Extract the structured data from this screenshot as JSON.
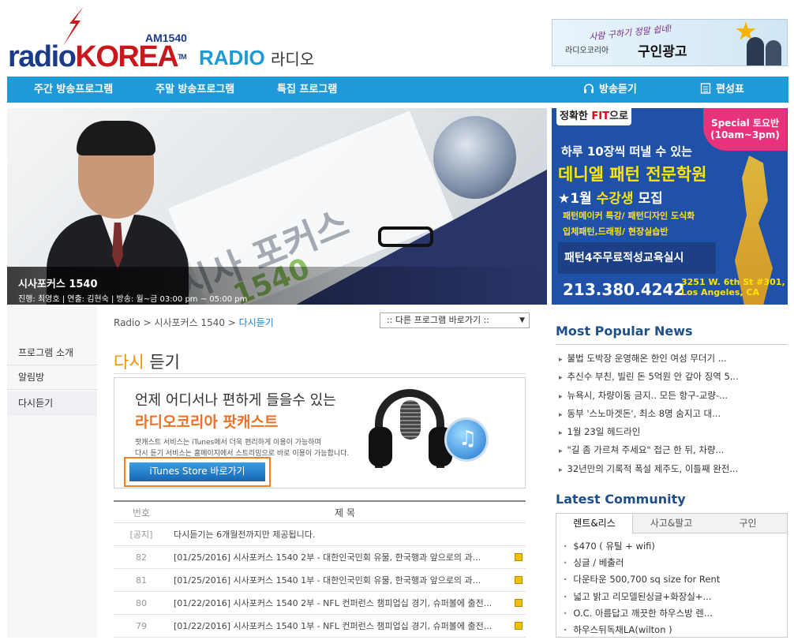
{
  "header": {
    "logo_am": "AM1540",
    "logo_radio": "radio",
    "logo_korea": "KOREA",
    "logo_tm": "TM",
    "radio_title": "RADIO",
    "radio_title_kr": "라디오",
    "top_ad": {
      "tagline": "사람 구하기 정말 쉽네!",
      "brand": "라디오코리아",
      "title": "구인광고"
    }
  },
  "nav": {
    "items": [
      "주간 방송프로그램",
      "주말 방송프로그램",
      "특집 프로그램"
    ],
    "listen": "방송듣기",
    "schedule": "편성표"
  },
  "banner": {
    "watermark1": "시사 포커스",
    "watermark2": "1540",
    "title": "시사포커스 1540",
    "info": "진행: 최영호 | 연출: 김현숙 | 방송: 월~금 03:00 pm ~ 05:00 pm"
  },
  "side_ad": {
    "tag_pre": "정확한 ",
    "tag_fit": "FIT",
    "tag_post": "으로",
    "badge1": "Special 토요반",
    "badge2": "(10am~3pm)",
    "line1": "하루 10장씩 떠낼 수 있는",
    "line2": "데니엘 패턴 전문학원",
    "line3a": "★1월 ",
    "line3b": "수강생",
    "line3c": " 모집",
    "line4": "패턴메이커 특강/ 패턴디자인 도식화",
    "line5": "입체패턴,드래핑/ 현장실습반",
    "line6": "패턴4주무료적성교육실시",
    "phone": "213.380.4242",
    "addr1": "3251 W. 6th St #301,",
    "addr2": "Los Angeles, CA"
  },
  "breadcrumb": {
    "root": "Radio",
    "sep": " > ",
    "mid": "시사포커스 1540",
    "current": "다시듣기"
  },
  "program_select": ":: 다른 프로그램 바로가기 ::",
  "left_menu": [
    "프로그램 소개",
    "알림방",
    "다시듣기"
  ],
  "page_title": {
    "highlight": "다시",
    "rest": " 듣기"
  },
  "podcast": {
    "headline": "언제 어디서나 편하게 들을수 있는",
    "title": "라디오코리아 팟캐스트",
    "desc1": "팟캐스트 서비스는 iTunes에서 더욱 편리하게 이용이 가능하며",
    "desc2": "다시 듣기 서비스는 홈페이지에서 스트리밍으로 바로 이용이 가능합니다.",
    "button": "iTunes Store 바로가기"
  },
  "table": {
    "col_num": "번호",
    "col_title": "제  목",
    "rows": [
      {
        "num": "[공지]",
        "title": "다시듣기는 6개월전까지만 제공됩니다."
      },
      {
        "num": "82",
        "title": "[01/25/2016]  시사포커스 1540 2부 - 대한인국민회 유물, 한국행과 앞으로의 과..."
      },
      {
        "num": "81",
        "title": "[01/25/2016]  시사포커스 1540 1부 - 대한인국민회 유물, 한국행과 앞으로의 과..."
      },
      {
        "num": "80",
        "title": "[01/22/2016]  시사포커스 1540 2부 - NFL 컨퍼런스 챔피업십 경기, 슈퍼볼에 출전..."
      },
      {
        "num": "79",
        "title": "[01/22/2016]  시사포커스 1540 1부 - NFL 컨퍼런스 챔피업십 경기, 슈퍼볼에 출전..."
      }
    ]
  },
  "most_popular": {
    "title": "Most Popular News",
    "items": [
      "불법 도박장 운영해온 한인 여성 무더기 ...",
      "추신수 부친, 빌린 돈 5억원 안 갚아 징역 5...",
      "뉴욕시, 차량이동 금지.. 모든 항구-교량-...",
      "동부 '스노마겟돈', 최소 8명 숨지고 대...",
      "1월 23일 헤드라인",
      "\"길 좀 가르쳐 주세요\" 접근 한 뒤, 차량...",
      "32년만의 기록적 폭설 제주도, 이틀째 완전..."
    ]
  },
  "latest_community": {
    "title": "Latest Community",
    "tabs": [
      "렌트&리스",
      "사고&팔고",
      "구인"
    ],
    "items": [
      "$470 ( 유틸 + wifi)",
      "싱글 / 베출러",
      "다운타운 500,700 sq size for Rent",
      "넓고 밝고 리모델된싱글+화장실+...",
      "O.C. 아름답고 깨끗한 하우스방 렌...",
      "하우스뒤독채LA(wilton )"
    ]
  }
}
